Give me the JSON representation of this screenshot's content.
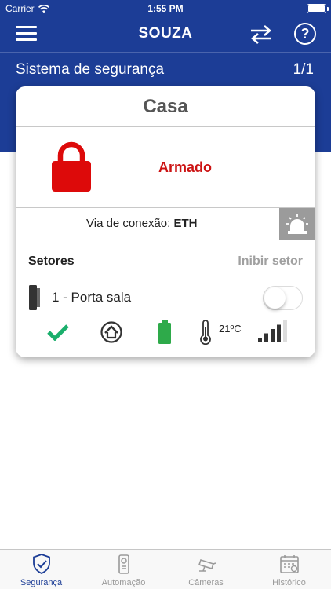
{
  "status_bar": {
    "carrier": "Carrier",
    "time": "1:55 PM"
  },
  "nav": {
    "title": "SOUZA",
    "help_glyph": "?",
    "icons": [
      "menu-icon",
      "swap-icon",
      "help-icon"
    ]
  },
  "system": {
    "title": "Sistema de segurança",
    "page": "1/1"
  },
  "card": {
    "title": "Casa",
    "state": "Armado",
    "state_color": "#cc1414",
    "connection_label": "Via de conexão: ",
    "connection_value": "ETH",
    "sectors_label": "Setores",
    "inhibit_label": "Inibir setor",
    "sector": {
      "name": "1 - Porta sala",
      "inhibited": false,
      "temperature": "21ºC",
      "signal_bars_filled": 4,
      "signal_bars_total": 5,
      "status_icons": [
        "check-icon",
        "home-icon",
        "battery-icon",
        "thermometer-icon",
        "signal-icon"
      ]
    }
  },
  "tabs": [
    {
      "label": "Segurança",
      "icon": "shield-icon",
      "active": true
    },
    {
      "label": "Automação",
      "icon": "remote-icon",
      "active": false
    },
    {
      "label": "Câmeras",
      "icon": "camera-icon",
      "active": false
    },
    {
      "label": "Histórico",
      "icon": "calendar-icon",
      "active": false
    }
  ],
  "colors": {
    "primary": "#1c3d96",
    "alarm_red": "#cc1414",
    "ok_green": "#1aaf6c",
    "battery_green": "#2eaa4a",
    "inactive": "#9a9a9a"
  }
}
